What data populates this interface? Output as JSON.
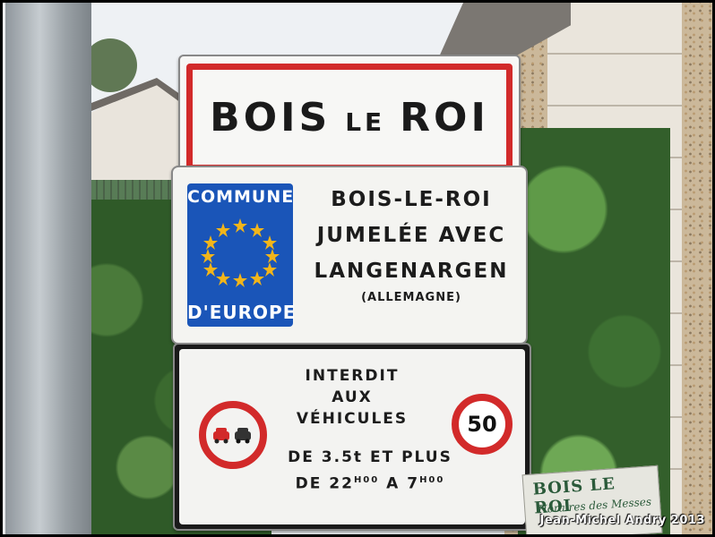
{
  "sign_top": {
    "word1": "BOIS",
    "word2": "LE",
    "word3": "ROI",
    "border_color": "#d22a2a"
  },
  "sign_middle": {
    "eu_top": "COMMUNE",
    "eu_bottom": "D'EUROPE",
    "eu_color": "#1a55b8",
    "line1": "BOIS-LE-ROI",
    "line2": "JUMELÉE AVEC",
    "line3": "LANGENARGEN",
    "line4": "(ALLEMAGNE)"
  },
  "sign_bottom": {
    "line1": "INTERDIT",
    "line2": "AUX",
    "line3": "VÉHICULES",
    "line4_pre": "DE 3.5t",
    "line4_post": "ET PLUS",
    "line5_pre": "DE 22",
    "line5_sup1": "H00",
    "line5_mid": "A 7",
    "line5_sup2": "H00",
    "speed_limit": "50",
    "icon_left": "no-overtaking-icon",
    "icon_right": "speed-limit-icon"
  },
  "mass_sign": {
    "title": "BOIS LE ROI",
    "subtitle": "Horaires des Messes"
  },
  "credit": "Jean-Michel  Andry 2013"
}
